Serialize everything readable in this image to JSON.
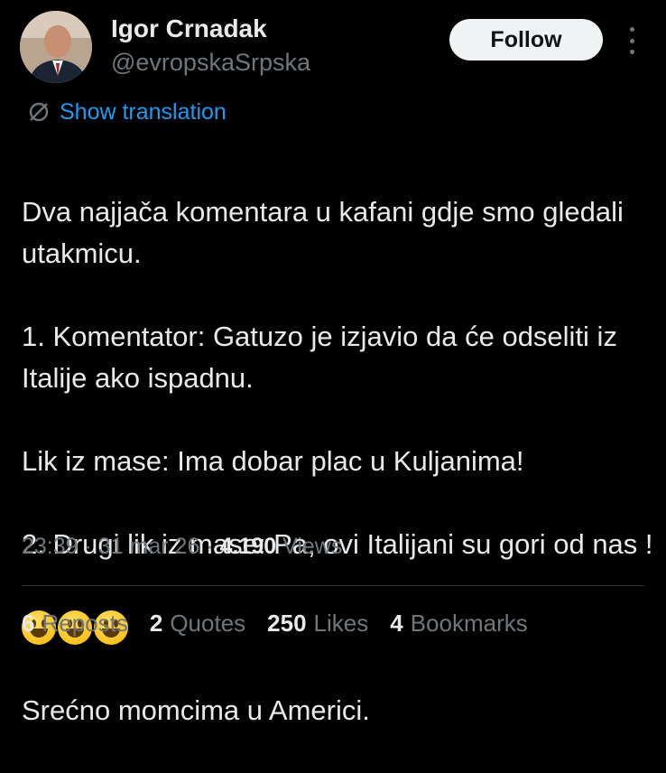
{
  "author": {
    "name": "Igor Crnadak",
    "handle": "@evropskaSrpska"
  },
  "follow_label": "Follow",
  "show_translation": "Show translation",
  "tweet": {
    "lines": [
      "Dva najjača komentara u kafani gdje smo gledali utakmicu.",
      "1. Komentator: Gatuzo je izjavio da će odseliti iz Italije ako ispadnu.",
      "Lik iz mase: Ima dobar plac u Kuljanima!",
      "2. Drugi lik iz mase: Pa, ovi Italijani su gori od nas !"
    ],
    "emoji": [
      "grinning-face",
      "grinning-face",
      "grinning-face"
    ],
    "closing": "Srećno momcima u Americi."
  },
  "meta": {
    "time": "23:39",
    "date": "31 mar 26",
    "views_count": "4.190",
    "views_label": "Views"
  },
  "stats": {
    "reposts_count": "6",
    "reposts_label": "Reposts",
    "quotes_count": "2",
    "quotes_label": "Quotes",
    "likes_count": "250",
    "likes_label": "Likes",
    "bookmarks_count": "4",
    "bookmarks_label": "Bookmarks"
  }
}
